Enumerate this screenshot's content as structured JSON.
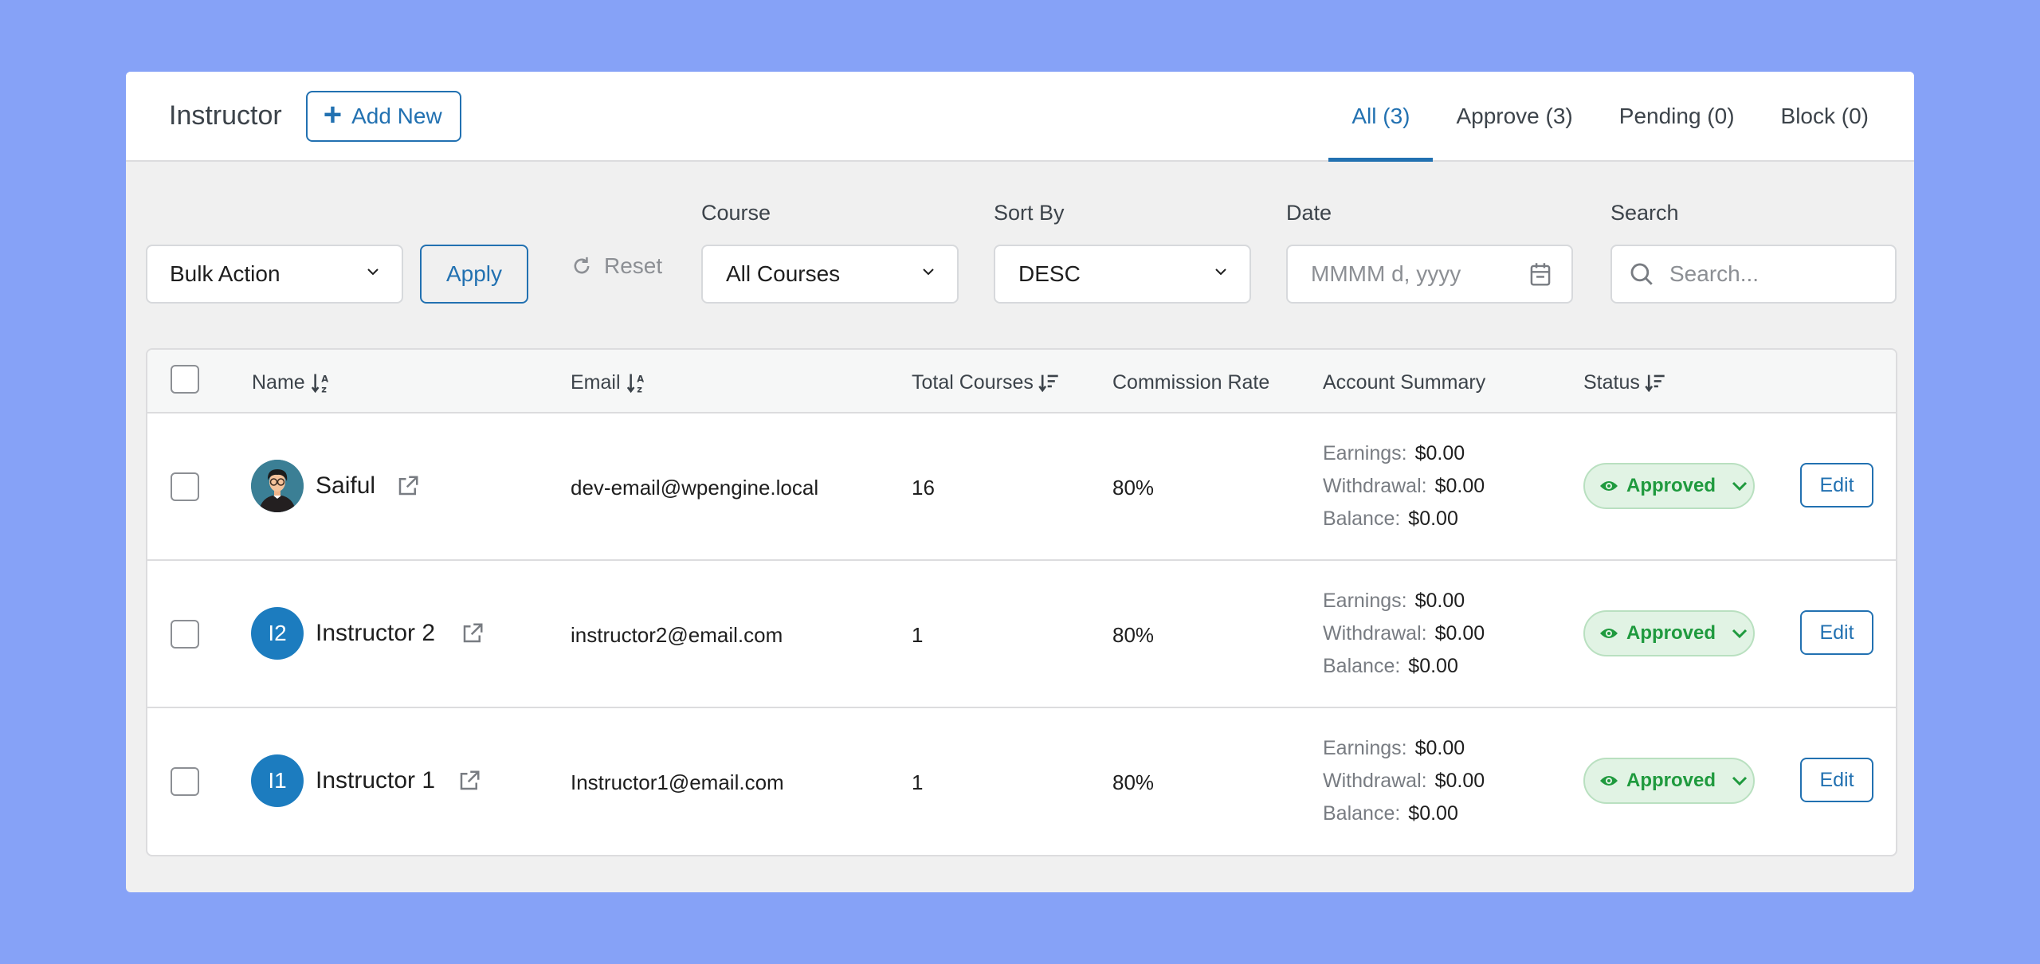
{
  "header": {
    "title": "Instructor",
    "add_new_label": "Add New",
    "tabs": [
      {
        "label": "All (3)",
        "active": true
      },
      {
        "label": "Approve (3)",
        "active": false
      },
      {
        "label": "Pending (0)",
        "active": false
      },
      {
        "label": "Block (0)",
        "active": false
      }
    ]
  },
  "filters": {
    "bulk_action": "Bulk Action",
    "apply_label": "Apply",
    "reset_label": "Reset",
    "course_label": "Course",
    "course_value": "All Courses",
    "sort_label": "Sort By",
    "sort_value": "DESC",
    "date_label": "Date",
    "date_placeholder": "MMMM d, yyyy",
    "search_label": "Search",
    "search_placeholder": "Search..."
  },
  "table": {
    "columns": {
      "name": "Name",
      "email": "Email",
      "total_courses": "Total Courses",
      "commission_rate": "Commission Rate",
      "account_summary": "Account Summary",
      "status": "Status"
    },
    "summary_labels": {
      "earnings": "Earnings:",
      "withdrawal": "Withdrawal:",
      "balance": "Balance:"
    },
    "edit_label": "Edit",
    "rows": [
      {
        "avatar": "",
        "avatar_type": "photo",
        "name": "Saiful",
        "email": "dev-email@wpengine.local",
        "total_courses": "16",
        "commission_rate": "80%",
        "earnings": "$0.00",
        "withdrawal": "$0.00",
        "balance": "$0.00",
        "status": "Approved"
      },
      {
        "avatar": "I2",
        "avatar_type": "initials",
        "name": "Instructor 2",
        "email": "instructor2@email.com",
        "total_courses": "1",
        "commission_rate": "80%",
        "earnings": "$0.00",
        "withdrawal": "$0.00",
        "balance": "$0.00",
        "status": "Approved"
      },
      {
        "avatar": "I1",
        "avatar_type": "initials",
        "name": "Instructor 1",
        "email": "Instructor1@email.com",
        "total_courses": "1",
        "commission_rate": "80%",
        "earnings": "$0.00",
        "withdrawal": "$0.00",
        "balance": "$0.00",
        "status": "Approved"
      }
    ]
  },
  "colors": {
    "accent": "#2271b1",
    "background": "#86a2f7",
    "status_green": "#1f9a3e",
    "avatar_blue": "#1c7cbf"
  }
}
